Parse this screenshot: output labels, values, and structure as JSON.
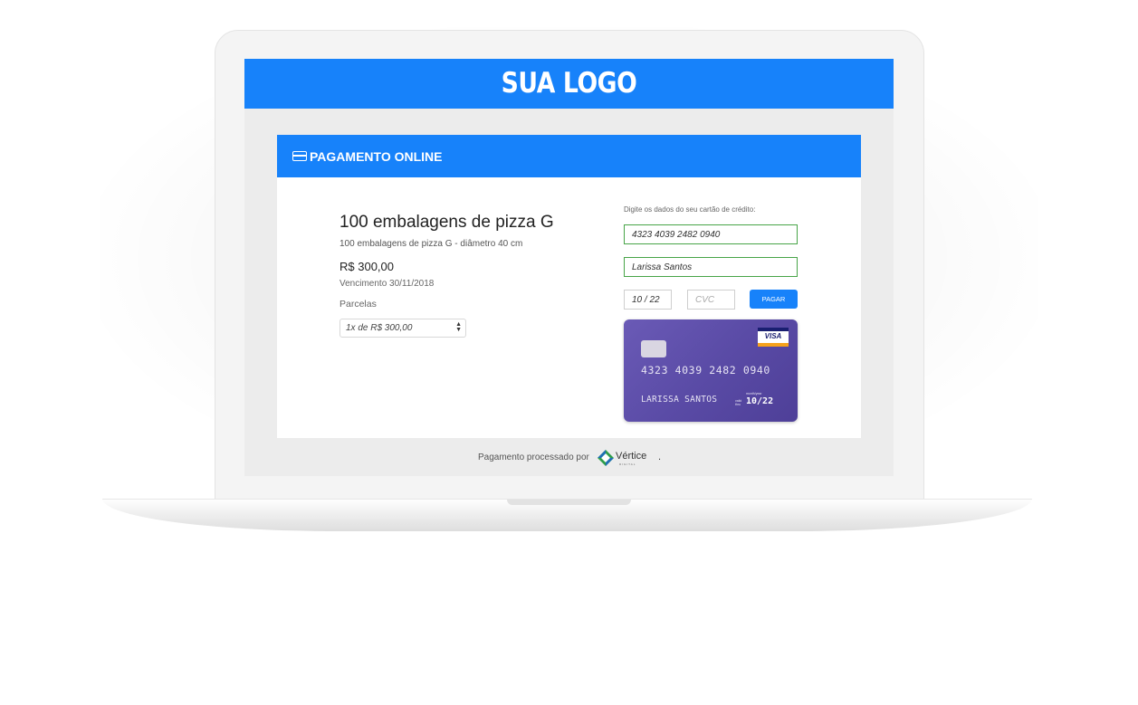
{
  "header": {
    "logo": "SUA LOGO"
  },
  "panel": {
    "title": "PAGAMENTO ONLINE"
  },
  "product": {
    "title": "100 embalagens de pizza G",
    "subtitle": "100 embalagens de pizza G - diâmetro 40 cm",
    "price": "R$ 300,00",
    "due_date": "Vencimento 30/11/2018",
    "installments_label": "Parcelas",
    "installments_selected": "1x de R$ 300,00"
  },
  "payment": {
    "instruction": "Digite os dados do seu cartão de crédito:",
    "card_number": "4323 4039 2482 0940",
    "card_name": "Larissa Santos",
    "expiry": "10 / 22",
    "cvc_placeholder": "CVC",
    "pay_button": "PAGAR"
  },
  "card_preview": {
    "brand": "VISA",
    "number": "4323 4039 2482 0940",
    "holder": "LARISSA SANTOS",
    "valid_thru_label": "valid thru",
    "month_year_label": "month/year",
    "expiry": "10/22"
  },
  "footer": {
    "processed_by": "Pagamento processado por",
    "brand_name": "Vértice",
    "brand_sub": "DIGITAL"
  },
  "colors": {
    "accent": "#1782fa",
    "card": "#5a4ba6",
    "valid_border": "#47a447"
  }
}
